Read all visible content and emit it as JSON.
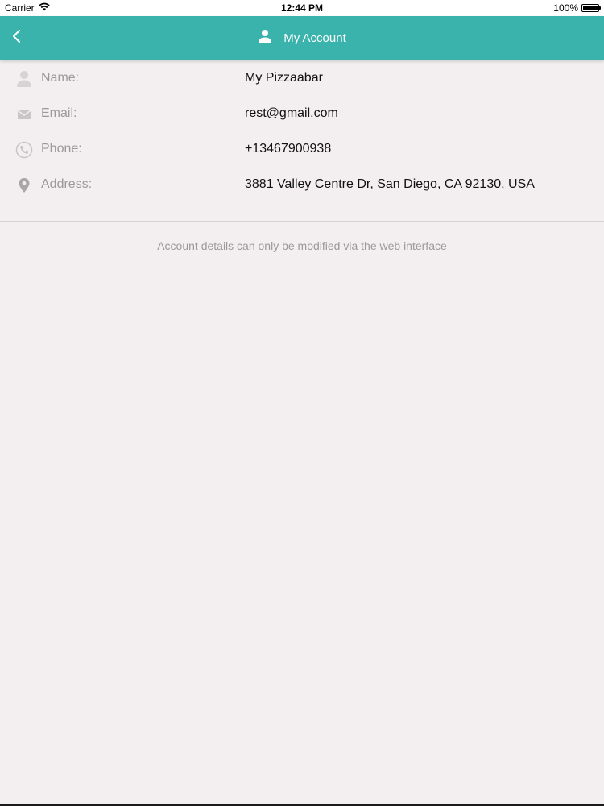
{
  "status_bar": {
    "carrier": "Carrier",
    "time": "12:44 PM",
    "battery": "100%",
    "battery_level": 1.0
  },
  "nav": {
    "title": "My Account",
    "background": "#3ab3ad"
  },
  "account": {
    "rows": [
      {
        "icon": "person-icon",
        "label": "Name:",
        "value": "My Pizzaabar"
      },
      {
        "icon": "envelope-icon",
        "label": "Email:",
        "value": "rest@gmail.com"
      },
      {
        "icon": "phone-icon",
        "label": "Phone:",
        "value": "+13467900938"
      },
      {
        "icon": "location-pin-icon",
        "label": "Address:",
        "value": "3881 Valley Centre Dr, San Diego, CA 92130, USA"
      }
    ]
  },
  "footer_note": "Account details can only be modified via the web interface"
}
